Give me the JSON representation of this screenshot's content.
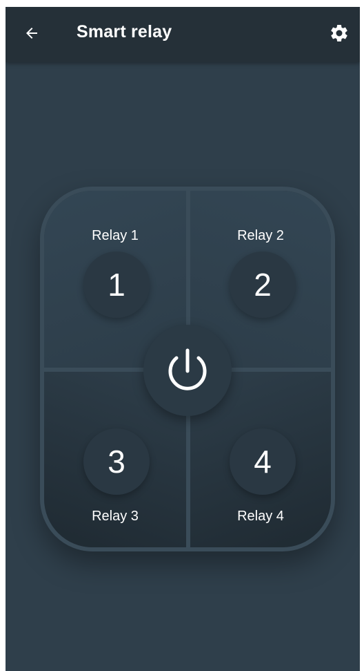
{
  "appbar": {
    "title": "Smart relay",
    "back_icon": "arrow-left-icon",
    "settings_icon": "gear-icon"
  },
  "relays": [
    {
      "label": "Relay 1",
      "number": "1"
    },
    {
      "label": "Relay 2",
      "number": "2"
    },
    {
      "label": "Relay 3",
      "number": "3"
    },
    {
      "label": "Relay 4",
      "number": "4"
    }
  ],
  "power": {
    "icon": "power-icon"
  },
  "colors": {
    "background": "#2f3f4b",
    "appbar": "#253038",
    "pad_border": "#3a4c59",
    "text": "#ffffff"
  }
}
